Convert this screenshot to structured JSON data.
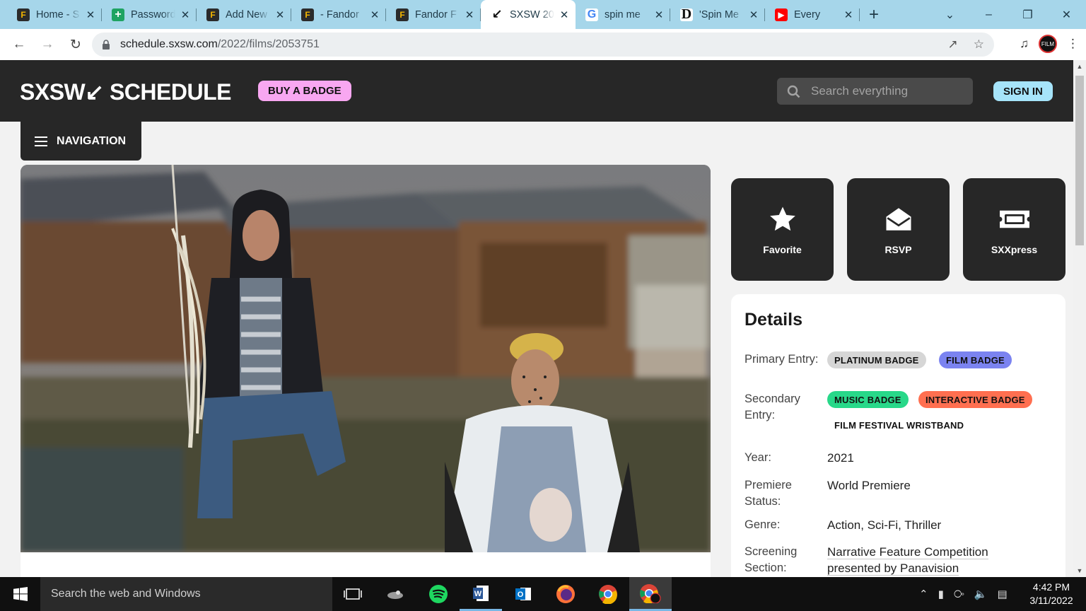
{
  "browser": {
    "tabs": [
      {
        "title": "Home - S",
        "icon": "fandor-icon",
        "color": "#2b2b2b"
      },
      {
        "title": "Passwords",
        "icon": "sheets-icon",
        "color": "#1ea362"
      },
      {
        "title": "Add New",
        "icon": "fandor-icon",
        "color": "#2b2b2b"
      },
      {
        "title": "- Fandor",
        "icon": "fandor-icon",
        "color": "#2b2b2b"
      },
      {
        "title": "Fandor F",
        "icon": "fandor-icon",
        "color": "#2b2b2b"
      },
      {
        "title": "SXSW 20",
        "icon": "sxsw-icon",
        "color": "#111111",
        "active": true
      },
      {
        "title": "spin me",
        "icon": "google-icon",
        "color": "#ffffff"
      },
      {
        "title": "'Spin Me",
        "icon": "deadline-icon",
        "color": "#ffffff"
      },
      {
        "title": "Every",
        "icon": "youtube-icon",
        "color": "#ff0000"
      }
    ],
    "url_host": "schedule.sxsw.com",
    "url_path": "/2022/films/2053751"
  },
  "site": {
    "logo": "SXSW↙ SCHEDULE",
    "buy_badge": "BUY A BADGE",
    "search_placeholder": "Search everything",
    "sign_in": "SIGN IN",
    "navigation": "NAVIGATION"
  },
  "actions": [
    {
      "label": "Favorite",
      "icon": "star-icon"
    },
    {
      "label": "RSVP",
      "icon": "envelope-icon"
    },
    {
      "label": "SXXpress",
      "icon": "ticket-icon"
    }
  ],
  "details": {
    "heading": "Details",
    "primary_entry_label": "Primary Entry:",
    "primary_entry": [
      {
        "text": "PLATINUM BADGE",
        "color": "#d6d6d6"
      },
      {
        "text": "FILM BADGE",
        "color": "#7b83f0"
      }
    ],
    "secondary_entry_label": "Secondary Entry:",
    "secondary_entry": [
      {
        "text": "MUSIC BADGE",
        "color": "#28d889"
      },
      {
        "text": "INTERACTIVE BADGE",
        "color": "#ff6f50"
      },
      {
        "text": "FILM FESTIVAL WRISTBAND",
        "color": "#ffffff"
      }
    ],
    "year_label": "Year:",
    "year": "2021",
    "premiere_label": "Premiere Status:",
    "premiere": "World Premiere",
    "genre_label": "Genre:",
    "genre": "Action, Sci-Fi, Thriller",
    "screening_label": "Screening Section:",
    "screening_line1": "Narrative Feature Competition",
    "screening_line2": "presented by Panavision"
  },
  "taskbar": {
    "search_placeholder": "Search the web and Windows",
    "time": "4:42 PM",
    "date": "3/11/2022"
  }
}
